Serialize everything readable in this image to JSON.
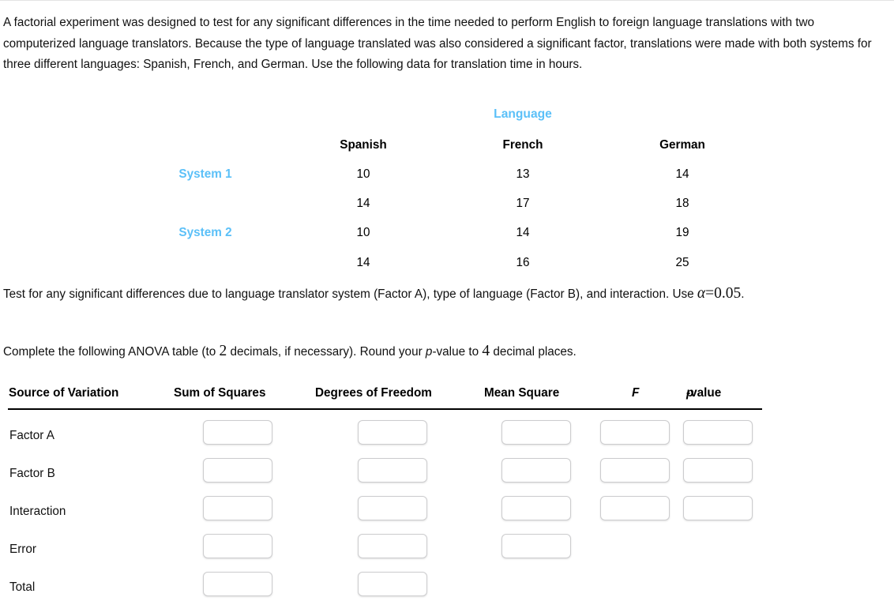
{
  "intro": {
    "paragraph": "A factorial experiment was designed to test for any significant differences in the time needed to perform English to foreign language translations with two computerized language translators. Because the type of language translated was also considered a significant factor, translations were made with both systems for three different languages: Spanish, French, and German. Use the following data for translation time in hours."
  },
  "data_table": {
    "group_header": "Language",
    "columns": [
      "Spanish",
      "French",
      "German"
    ],
    "rows": [
      {
        "label": "System 1",
        "values": [
          "10",
          "13",
          "14"
        ]
      },
      {
        "label": "",
        "values": [
          "14",
          "17",
          "18"
        ]
      },
      {
        "label": "System 2",
        "values": [
          "10",
          "14",
          "19"
        ]
      },
      {
        "label": "",
        "values": [
          "14",
          "16",
          "25"
        ]
      }
    ],
    "label_color": "#5BC0F8"
  },
  "prompts": {
    "test_line_a": "Test for any significant differences due to language translator system (Factor A), type of language (Factor B), and",
    "test_line_b_prefix": "interaction. Use ",
    "alpha_symbol": "α",
    "alpha_equals": "=",
    "alpha_value": "0.05",
    "test_line_b_suffix": ".",
    "complete_prefix": "Complete the following ANOVA table (to ",
    "decimals_count": "2",
    "complete_mid": " decimals, if necessary). Round your ",
    "p_italic": "p",
    "complete_mid2": "-value to ",
    "places_count": "4",
    "complete_suffix": " decimal places."
  },
  "anova": {
    "headers": {
      "source": "Source of Variation",
      "sum_of_squares": "Sum of Squares",
      "degrees_of_freedom": "Degrees of Freedom",
      "mean_square": "Mean Square",
      "f": "F",
      "p_value_italic": "p",
      "p_value_rest": "-value"
    },
    "rows": [
      {
        "label": "Factor A",
        "inputs": 5,
        "values": [
          "",
          "",
          "",
          "",
          ""
        ]
      },
      {
        "label": "Factor B",
        "inputs": 5,
        "values": [
          "",
          "",
          "",
          "",
          ""
        ]
      },
      {
        "label": "Interaction",
        "inputs": 5,
        "values": [
          "",
          "",
          "",
          "",
          ""
        ]
      },
      {
        "label": "Error",
        "inputs": 3,
        "values": [
          "",
          "",
          ""
        ]
      },
      {
        "label": "Total",
        "inputs": 2,
        "values": [
          "",
          ""
        ]
      }
    ]
  }
}
